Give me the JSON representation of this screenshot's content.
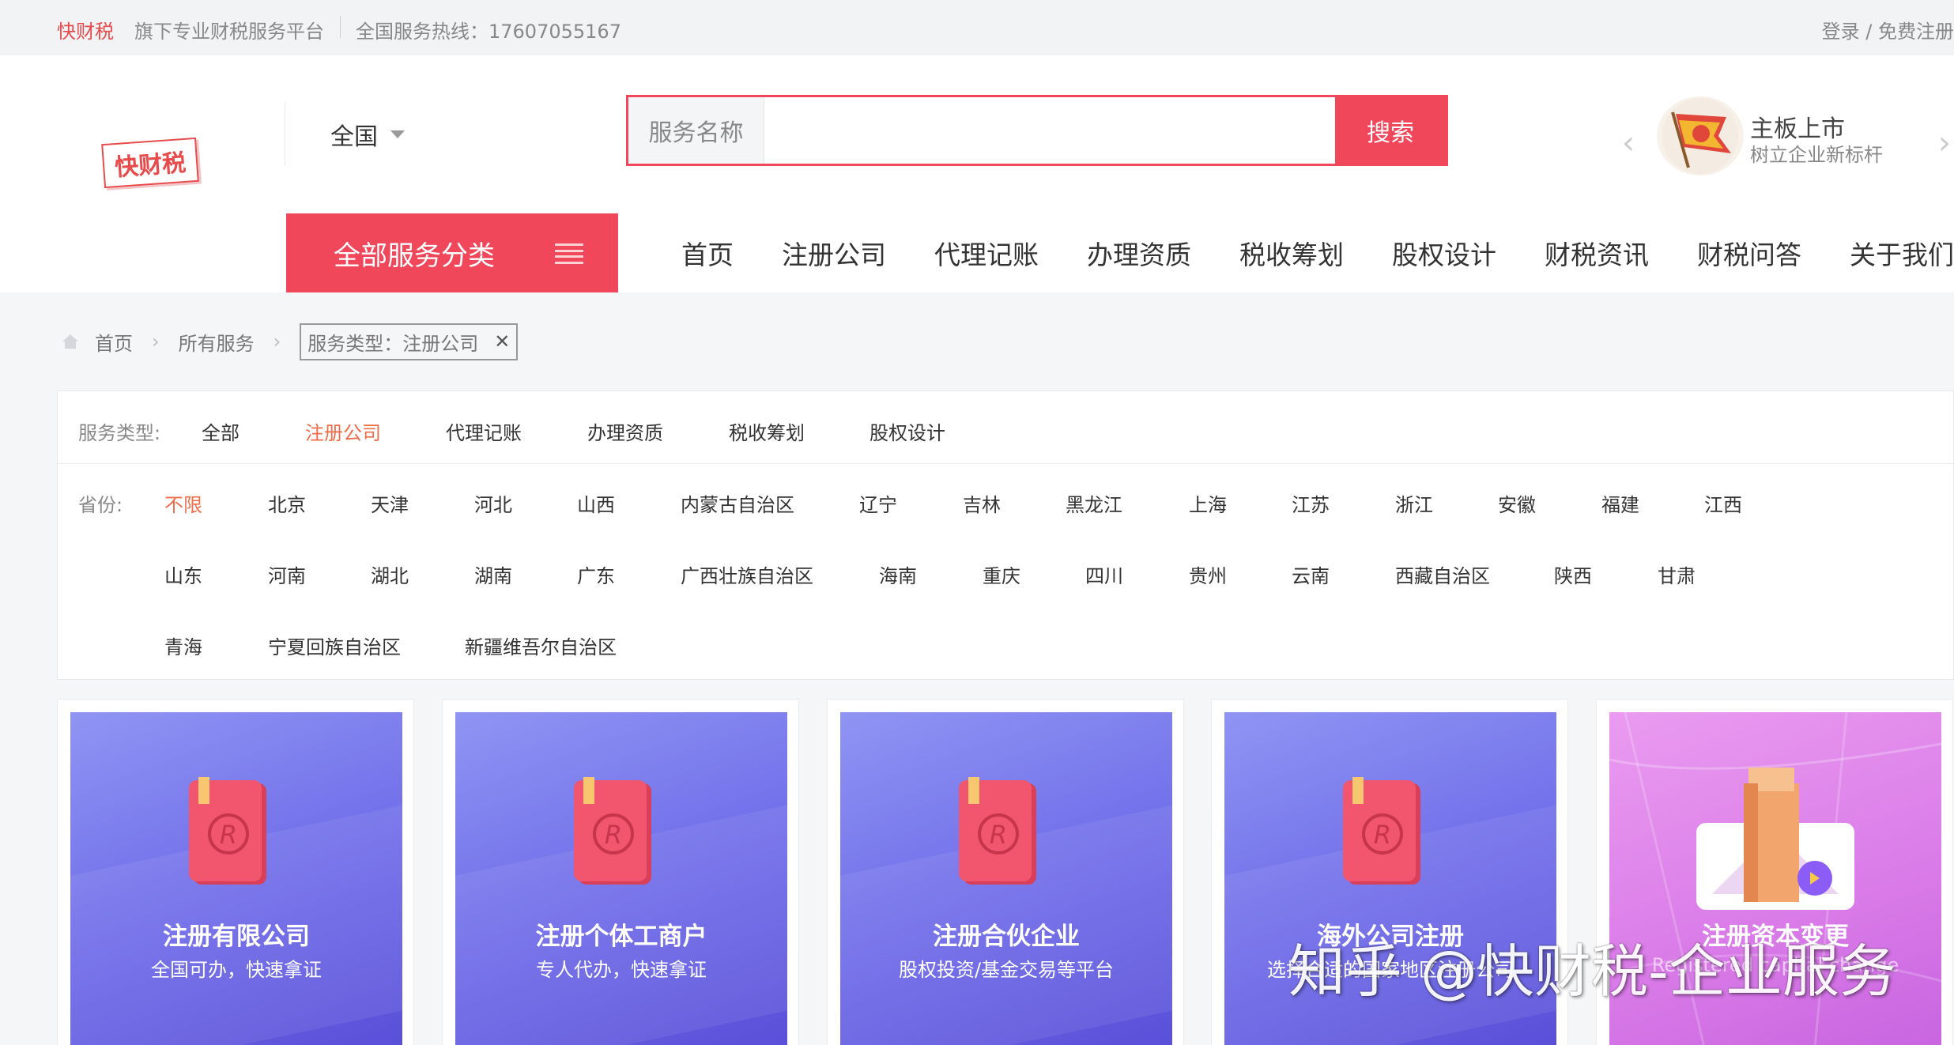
{
  "topbar": {
    "brand": "快财税",
    "slogan": "旗下专业财税服务平台",
    "hotline": "全国服务热线：17607055167",
    "login": "登录 / 免费注册"
  },
  "header": {
    "logo": "快财税",
    "region": "全国",
    "search_label": "服务名称",
    "search_placeholder": "",
    "search_button": "搜索",
    "promo": {
      "title": "主板上市",
      "subtitle": "树立企业新标杆"
    },
    "all_categories": "全部服务分类",
    "nav": [
      "首页",
      "注册公司",
      "代理记账",
      "办理资质",
      "税收筹划",
      "股权设计",
      "财税资讯",
      "财税问答",
      "关于我们"
    ]
  },
  "breadcrumb": {
    "home": "首页",
    "all": "所有服务",
    "tag": "服务类型：注册公司"
  },
  "filter": {
    "service_label": "服务类型:",
    "service_types": [
      "全部",
      "注册公司",
      "代理记账",
      "办理资质",
      "税收筹划",
      "股权设计"
    ],
    "service_active": "注册公司",
    "province_label": "省份:",
    "provinces_row1": [
      "不限",
      "北京",
      "天津",
      "河北",
      "山西",
      "内蒙古自治区",
      "辽宁",
      "吉林",
      "黑龙江",
      "上海",
      "江苏",
      "浙江",
      "安徽",
      "福建",
      "江西"
    ],
    "provinces_row2": [
      "山东",
      "河南",
      "湖北",
      "湖南",
      "广东",
      "广西壮族自治区",
      "海南",
      "重庆",
      "四川",
      "贵州",
      "云南",
      "西藏自治区",
      "陕西",
      "甘肃"
    ],
    "provinces_row3": [
      "青海",
      "宁夏回族自治区",
      "新疆维吾尔自治区"
    ],
    "province_active": "不限"
  },
  "cards": [
    {
      "title": "注册有限公司",
      "subtitle": "全国可办，快速拿证"
    },
    {
      "title": "注册个体工商户",
      "subtitle": "专人代办，快速拿证"
    },
    {
      "title": "注册合伙企业",
      "subtitle": "股权投资/基金交易等平台"
    },
    {
      "title": "海外公司注册",
      "subtitle": "选择合适的国家地区注册公司"
    },
    {
      "title": "注册资本变更",
      "subtitle": "Registered capital change"
    }
  ],
  "watermark": "知乎 @快财税-企业服务",
  "colors": {
    "accent": "#f0475b",
    "active": "#ef6c47"
  }
}
